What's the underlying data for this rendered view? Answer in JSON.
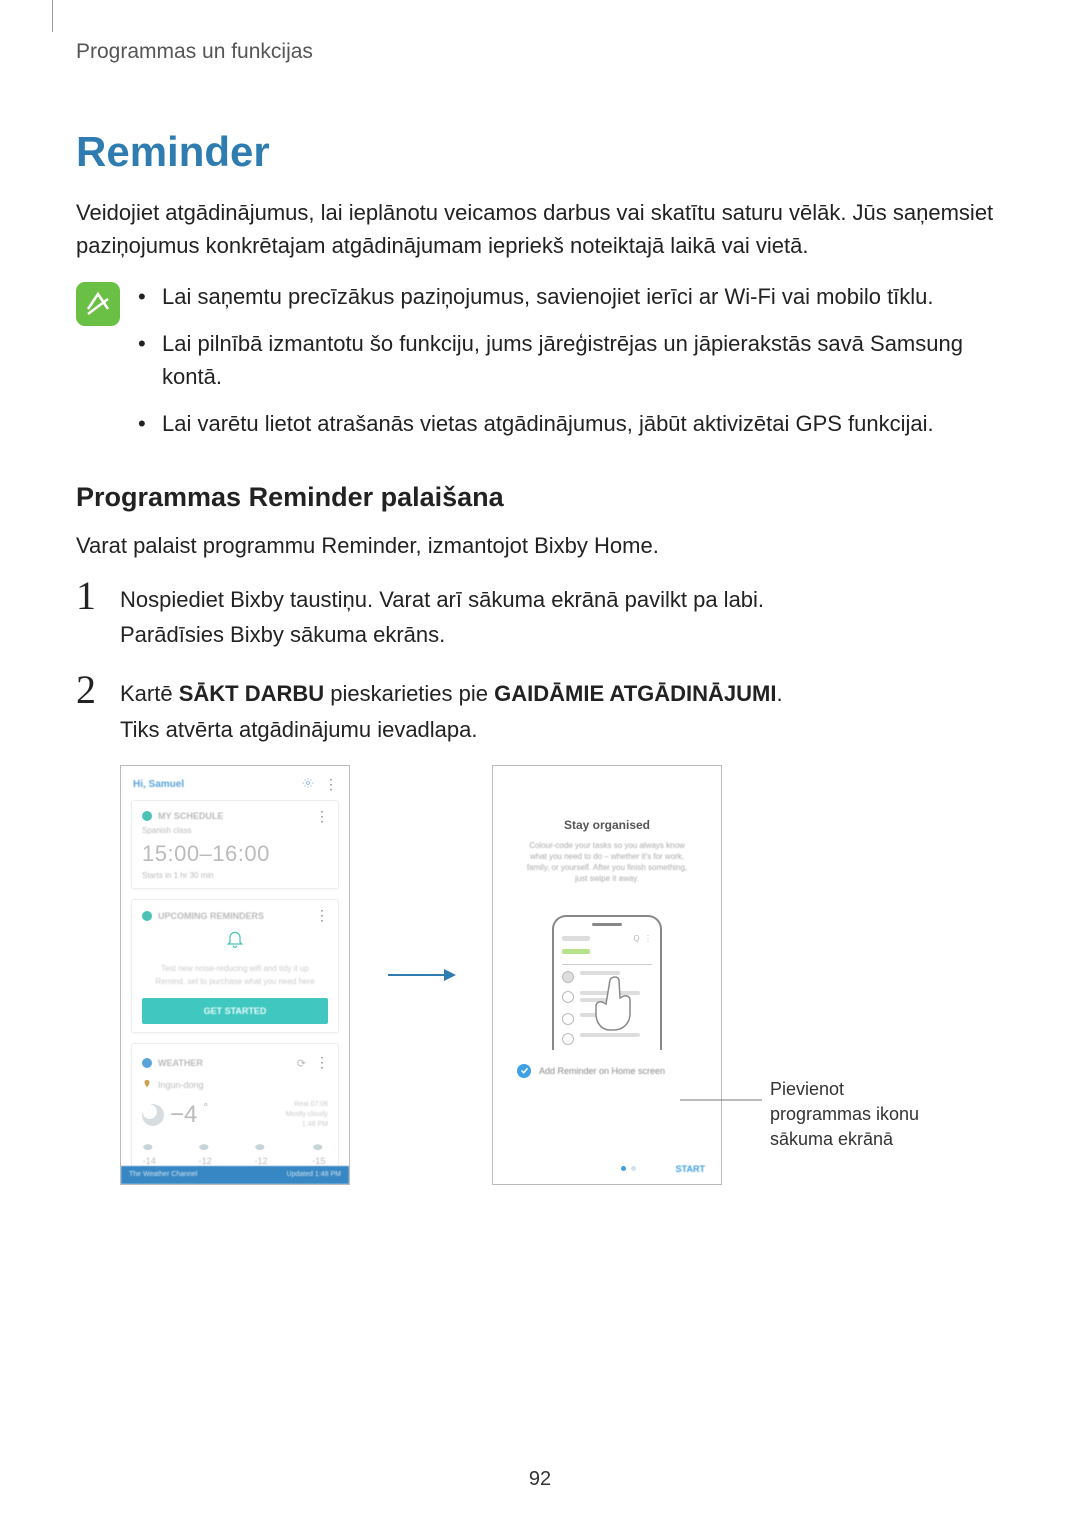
{
  "breadcrumb": "Programmas un funkcijas",
  "title": "Reminder",
  "intro": "Veidojiet atgādinājumus, lai ieplānotu veicamos darbus vai skatītu saturu vēlāk. Jūs saņemsiet paziņojumus konkrētajam atgādinājumam iepriekš noteiktajā laikā vai vietā.",
  "notes": [
    "Lai saņemtu precīzākus paziņojumus, savienojiet ierīci ar Wi-Fi vai mobilo tīklu.",
    "Lai pilnībā izmantotu šo funkciju, jums jāreģistrējas un jāpierakstās savā Samsung kontā.",
    "Lai varētu lietot atrašanās vietas atgādinājumus, jābūt aktivizētai GPS funkcijai."
  ],
  "subheading": "Programmas Reminder palaišana",
  "sub_intro": "Varat palaist programmu Reminder, izmantojot Bixby Home.",
  "steps": {
    "s1_num": "1",
    "s1_a": "Nospiediet Bixby taustiņu. Varat arī sākuma ekrānā pavilkt pa labi.",
    "s1_b": "Parādīsies Bixby sākuma ekrāns.",
    "s2_num": "2",
    "s2_a_pre": "Kartē ",
    "s2_a_b1": "SĀKT DARBU",
    "s2_a_mid": " pieskarieties pie ",
    "s2_a_b2": "GAIDĀMIE ATGĀDINĀJUMI",
    "s2_a_post": ".",
    "s2_b": "Tiks atvērta atgādinājumu ievadlapa."
  },
  "left_screen": {
    "greeting": "Hi, Samuel",
    "card1": {
      "chip": "MY SCHEDULE",
      "title": "Spanish class",
      "time": "15:00–16:00",
      "sub": "Starts in 1 hr 30 min"
    },
    "card2": {
      "chip": "UPCOMING REMINDERS",
      "desc1": "Test new noise-reducing wifi and tidy it up",
      "desc2": "Remind. set to purchase what you need here",
      "button": "GET STARTED"
    },
    "card3": {
      "chip": "WEATHER",
      "place": "Ingun-dong",
      "temp": "−4",
      "right1": "Real 07:06",
      "right2": "Mostly cloudy",
      "right3": "1:48 PM",
      "h1": "-14",
      "h2": "-12",
      "h3": "-12",
      "h4": "-15"
    },
    "footer_l": "The Weather Channel",
    "footer_r": "Updated 1:48 PM"
  },
  "right_screen": {
    "title": "Stay organised",
    "desc": "Colour-code your tasks so you always know what you need to do – whether it's for work, family, or yourself. After you finish something, just swipe it away.",
    "add_label": "Add Reminder on Home screen",
    "start": "START"
  },
  "callout": "Pievienot programmas ikonu sākuma ekrānā",
  "page_number": "92"
}
